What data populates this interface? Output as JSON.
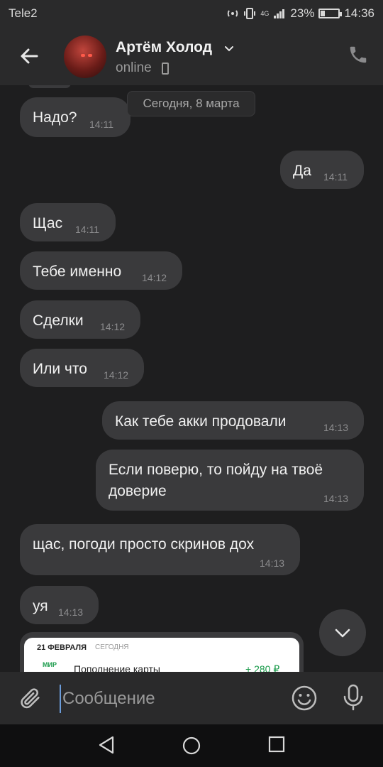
{
  "status_bar": {
    "carrier": "Tele2",
    "network": "4G",
    "battery": "23%",
    "battery_level": 0.23,
    "time": "14:36"
  },
  "header": {
    "contact_name": "Артём Холод",
    "status": "online"
  },
  "chat": {
    "date_divider": "Сегодня, 8 марта",
    "messages": [
      {
        "text": "Надо?",
        "time": "14:11",
        "direction": "in"
      },
      {
        "text": "Да",
        "time": "14:11",
        "direction": "out"
      },
      {
        "text": "Щас",
        "time": "14:11",
        "direction": "in"
      },
      {
        "text": "Тебе именно",
        "time": "14:12",
        "direction": "in"
      },
      {
        "text": "Сделки",
        "time": "14:12",
        "direction": "in"
      },
      {
        "text": "Или что",
        "time": "14:12",
        "direction": "in"
      },
      {
        "text": "Как тебе акки продовали",
        "time": "14:13",
        "direction": "out"
      },
      {
        "text": "Если поверю, то пойду на твоё доверие",
        "time": "14:13",
        "direction": "out"
      },
      {
        "text": "щас, погоди просто скринов дох",
        "time": "14:13",
        "direction": "in"
      },
      {
        "text": "уя",
        "time": "14:13",
        "direction": "in"
      }
    ],
    "attachment": {
      "date": "21 ФЕВРАЛЯ",
      "today": "СЕГОДНЯ",
      "logo": "МИР",
      "title": "Пополнение карты",
      "amount": "+ 280 ₽"
    }
  },
  "composer": {
    "placeholder": "Сообщение"
  },
  "icons": {
    "back": "arrow-left-icon",
    "call": "phone-icon",
    "attach": "paperclip-icon",
    "emoji": "smiley-icon",
    "mic": "microphone-icon",
    "scroll": "chevron-down-icon"
  },
  "colors": {
    "background": "#1e1e1f",
    "bar": "#2a2a2b",
    "bubble": "#3a3a3c",
    "accent": "#6b9bd8"
  }
}
